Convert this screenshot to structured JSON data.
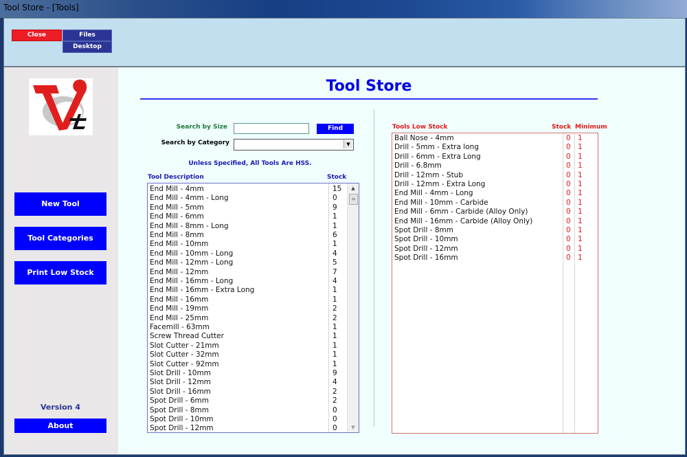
{
  "window": {
    "title": "Tool Store - [Tools]"
  },
  "header": {
    "close_label": "Close",
    "files_label": "Files",
    "desktop_label": "Desktop"
  },
  "sidebar": {
    "buttons": [
      {
        "label": "New Tool"
      },
      {
        "label": "Tool Categories"
      },
      {
        "label": "Print Low Stock"
      }
    ],
    "version": "Version 4",
    "about_label": "About"
  },
  "main": {
    "title": "Tool Store",
    "search_size_label": "Search by Size",
    "search_size_value": "",
    "find_label": "Find",
    "search_category_label": "Search by Category",
    "search_category_value": "",
    "note": "Unless Specified, All Tools Are HSS.",
    "tools_header": {
      "description": "Tool Description",
      "stock": "Stock"
    },
    "tools": [
      {
        "description": "End Mill - 4mm",
        "stock": "15"
      },
      {
        "description": "End Mill - 4mm - Long",
        "stock": "0"
      },
      {
        "description": "End Mill - 5mm",
        "stock": "9"
      },
      {
        "description": "End Mill - 6mm",
        "stock": "1"
      },
      {
        "description": "End Mill - 8mm - Long",
        "stock": "1"
      },
      {
        "description": "End Mill - 8mm",
        "stock": "6"
      },
      {
        "description": "End Mill - 10mm",
        "stock": "1"
      },
      {
        "description": "End Mill - 10mm - Long",
        "stock": "4"
      },
      {
        "description": "End Mill - 12mm - Long",
        "stock": "5"
      },
      {
        "description": "End Mill - 12mm",
        "stock": "7"
      },
      {
        "description": "End Mill - 16mm - Long",
        "stock": "4"
      },
      {
        "description": "End Mill - 16mm - Extra Long",
        "stock": "1"
      },
      {
        "description": "End Mill - 16mm",
        "stock": "1"
      },
      {
        "description": "End Mill - 19mm",
        "stock": "2"
      },
      {
        "description": "End Mill - 25mm",
        "stock": "2"
      },
      {
        "description": "Facemill - 63mm",
        "stock": "1"
      },
      {
        "description": "Screw Thread Cutter",
        "stock": "1"
      },
      {
        "description": "Slot Cutter - 21mm",
        "stock": "1"
      },
      {
        "description": "Slot Cutter - 32mm",
        "stock": "1"
      },
      {
        "description": "Slot Cutter - 92mm",
        "stock": "1"
      },
      {
        "description": "Slot Drill - 10mm",
        "stock": "9"
      },
      {
        "description": "Slot Drill - 12mm",
        "stock": "4"
      },
      {
        "description": "Slot Drill - 16mm",
        "stock": "2"
      },
      {
        "description": "Spot Drill - 6mm",
        "stock": "2"
      },
      {
        "description": "Spot Drill - 8mm",
        "stock": "0"
      },
      {
        "description": "Spot Drill - 10mm",
        "stock": "0"
      },
      {
        "description": "Spot Drill - 12mm",
        "stock": "0"
      }
    ],
    "low_stock_header": {
      "title": "Tools Low Stock",
      "stock": "Stock",
      "minimum": "Minimum"
    },
    "low_stock": [
      {
        "description": "Ball Nose - 4mm",
        "stock": "0",
        "minimum": "1"
      },
      {
        "description": "Drill - 5mm - Extra long",
        "stock": "0",
        "minimum": "1"
      },
      {
        "description": "Drill - 6mm - Extra Long",
        "stock": "0",
        "minimum": "1"
      },
      {
        "description": "Drill - 6.8mm",
        "stock": "0",
        "minimum": "1"
      },
      {
        "description": "Drill - 12mm - Stub",
        "stock": "0",
        "minimum": "1"
      },
      {
        "description": "Drill - 12mm - Extra Long",
        "stock": "0",
        "minimum": "1"
      },
      {
        "description": "End Mill - 4mm - Long",
        "stock": "0",
        "minimum": "1"
      },
      {
        "description": "End Mill - 10mm - Carbide",
        "stock": "0",
        "minimum": "1"
      },
      {
        "description": "End Mill - 6mm - Carbide (Alloy Only)",
        "stock": "0",
        "minimum": "1"
      },
      {
        "description": "End Mill - 16mm - Carbide (Alloy Only)",
        "stock": "0",
        "minimum": "1"
      },
      {
        "description": "Spot Drill - 8mm",
        "stock": "0",
        "minimum": "1"
      },
      {
        "description": "Spot Drill - 10mm",
        "stock": "0",
        "minimum": "1"
      },
      {
        "description": "Spot Drill - 12mm",
        "stock": "0",
        "minimum": "1"
      },
      {
        "description": "Spot Drill - 16mm",
        "stock": "0",
        "minimum": "1"
      }
    ]
  },
  "colors": {
    "accent_blue": "#0000ff",
    "close_red": "#ee1c25",
    "low_stock_red": "#e01a1a",
    "header_bg": "#c2dff0"
  }
}
